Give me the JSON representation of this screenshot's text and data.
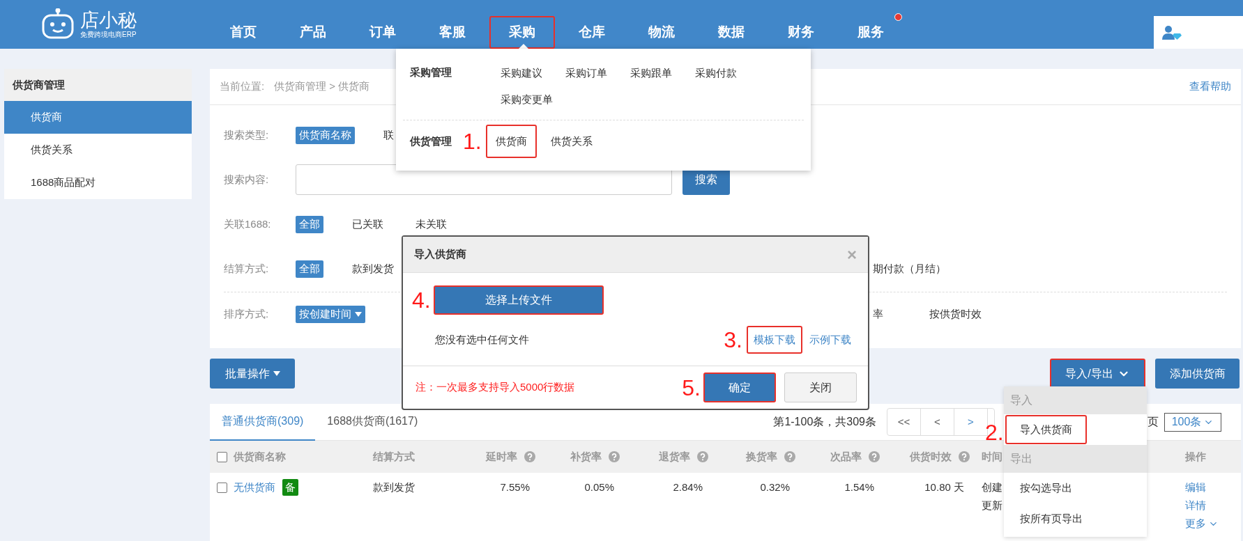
{
  "logo": {
    "name": "店小秘",
    "tagline": "免费跨境电商ERP"
  },
  "nav": [
    {
      "label": "首页",
      "selected": false,
      "highlight": false,
      "notification": false
    },
    {
      "label": "产品",
      "selected": false,
      "highlight": false,
      "notification": false
    },
    {
      "label": "订单",
      "selected": false,
      "highlight": false,
      "notification": false
    },
    {
      "label": "客服",
      "selected": false,
      "highlight": false,
      "notification": false
    },
    {
      "label": "采购",
      "selected": true,
      "highlight": true,
      "notification": false
    },
    {
      "label": "仓库",
      "selected": false,
      "highlight": false,
      "notification": false
    },
    {
      "label": "物流",
      "selected": false,
      "highlight": false,
      "notification": false
    },
    {
      "label": "数据",
      "selected": false,
      "highlight": false,
      "notification": false
    },
    {
      "label": "财务",
      "selected": false,
      "highlight": false,
      "notification": false
    },
    {
      "label": "服务",
      "selected": false,
      "highlight": false,
      "notification": true
    }
  ],
  "sidebar": {
    "title": "供货商管理",
    "items": [
      {
        "label": "供货商",
        "selected": true
      },
      {
        "label": "供货关系",
        "selected": false
      },
      {
        "label": "1688商品配对",
        "selected": false
      }
    ]
  },
  "breadcrumb": {
    "label": "当前位置:",
    "path": "供货商管理 > 供货商"
  },
  "help_link": "查看帮助",
  "filters": [
    {
      "kind": "options",
      "label": "搜索类型:",
      "options": [
        {
          "label": "供货商名称",
          "selected": true
        },
        {
          "label": "联",
          "selected": false
        }
      ]
    },
    {
      "kind": "search",
      "label": "搜索内容:",
      "button": "搜索"
    },
    {
      "kind": "options",
      "label": "关联1688:",
      "options": [
        {
          "label": "全部",
          "selected": true
        },
        {
          "label": "已关联",
          "selected": false
        },
        {
          "label": "未关联",
          "selected": false
        }
      ]
    },
    {
      "kind": "options",
      "label": "结算方式:",
      "options": [
        {
          "label": "全部",
          "selected": true
        },
        {
          "label": "款到发货",
          "selected": false
        }
      ],
      "options_after_dialog": [
        {
          "label": "期付款（月结）",
          "selected": false
        }
      ]
    },
    {
      "kind": "sort",
      "label": "排序方式:",
      "options": [
        {
          "label": "按创建时间",
          "selected": true
        }
      ],
      "options_after_dialog": [
        {
          "label": "率",
          "selected": false
        },
        {
          "label": "按供货时效",
          "selected": false
        }
      ]
    }
  ],
  "actions": {
    "batch": "批量操作",
    "import_export": {
      "label": "导入/导出",
      "highlight": true
    },
    "add": "添加供货商"
  },
  "table": {
    "tabs": [
      {
        "label": "普通供货商(309)",
        "selected": true
      },
      {
        "label": "1688供货商(1617)",
        "selected": false
      }
    ],
    "pagination": {
      "summary": "第1-100条，共309条",
      "pages": [
        "<<",
        "<",
        ">"
      ],
      "page_suffix": "页",
      "page_size": "100条"
    },
    "columns": [
      {
        "kind": "check",
        "checked": false
      },
      {
        "kind": "text",
        "label": "供货商名称"
      },
      {
        "kind": "text",
        "label": "结算方式"
      },
      {
        "kind": "rate",
        "label": "延时率"
      },
      {
        "kind": "rate",
        "label": "补货率"
      },
      {
        "kind": "rate",
        "label": "退货率"
      },
      {
        "kind": "rate",
        "label": "换货率"
      },
      {
        "kind": "rate",
        "label": "次品率"
      },
      {
        "kind": "rate",
        "label": "供货时效"
      },
      {
        "kind": "text",
        "label": "时间"
      },
      {
        "kind": "text",
        "label": "操作"
      }
    ],
    "rows": [
      {
        "checked": false,
        "name": "无供货商",
        "badge": "备",
        "payment": "款到发货",
        "rates": [
          "7.55%",
          "0.05%",
          "2.84%",
          "0.32%",
          "1.54%",
          "10.80 天"
        ],
        "time": [
          "创建",
          "更新"
        ],
        "actions": [
          "编辑",
          "详情",
          "更多"
        ]
      }
    ]
  },
  "purchase_menu": {
    "groups": [
      {
        "title": "采购管理",
        "items": [
          {
            "label": "采购建议",
            "highlight": false
          },
          {
            "label": "采购订单",
            "highlight": false
          },
          {
            "label": "采购跟单",
            "highlight": false
          },
          {
            "label": "采购付款",
            "highlight": false
          },
          {
            "label": "采购变更单",
            "highlight": false
          }
        ]
      },
      {
        "title": "供货管理",
        "items": [
          {
            "label": "供货商",
            "highlight": true,
            "step": "1."
          },
          {
            "label": "供货关系",
            "highlight": false
          }
        ]
      }
    ]
  },
  "dialog": {
    "title": "导入供货商",
    "close": "×",
    "upload": {
      "label": "选择上传文件",
      "highlight": true,
      "step": "4."
    },
    "status": "您没有选中任何文件",
    "links": [
      {
        "label": "模板下载",
        "highlight": true,
        "step": "3."
      },
      {
        "label": "示例下载",
        "highlight": false
      }
    ],
    "note": "注：一次最多支持导入5000行数据",
    "buttons": [
      {
        "label": "确定",
        "kind": "primary",
        "highlight": true,
        "step": "5."
      },
      {
        "label": "关闭",
        "kind": "default",
        "highlight": false
      }
    ]
  },
  "export_menu": {
    "sections": [
      {
        "header": "导入",
        "items": [
          {
            "label": "导入供货商",
            "highlight": true,
            "step": "2."
          }
        ]
      },
      {
        "header": "导出",
        "items": [
          {
            "label": "按勾选导出",
            "highlight": false
          },
          {
            "label": "按所有页导出",
            "highlight": false
          }
        ]
      }
    ]
  }
}
